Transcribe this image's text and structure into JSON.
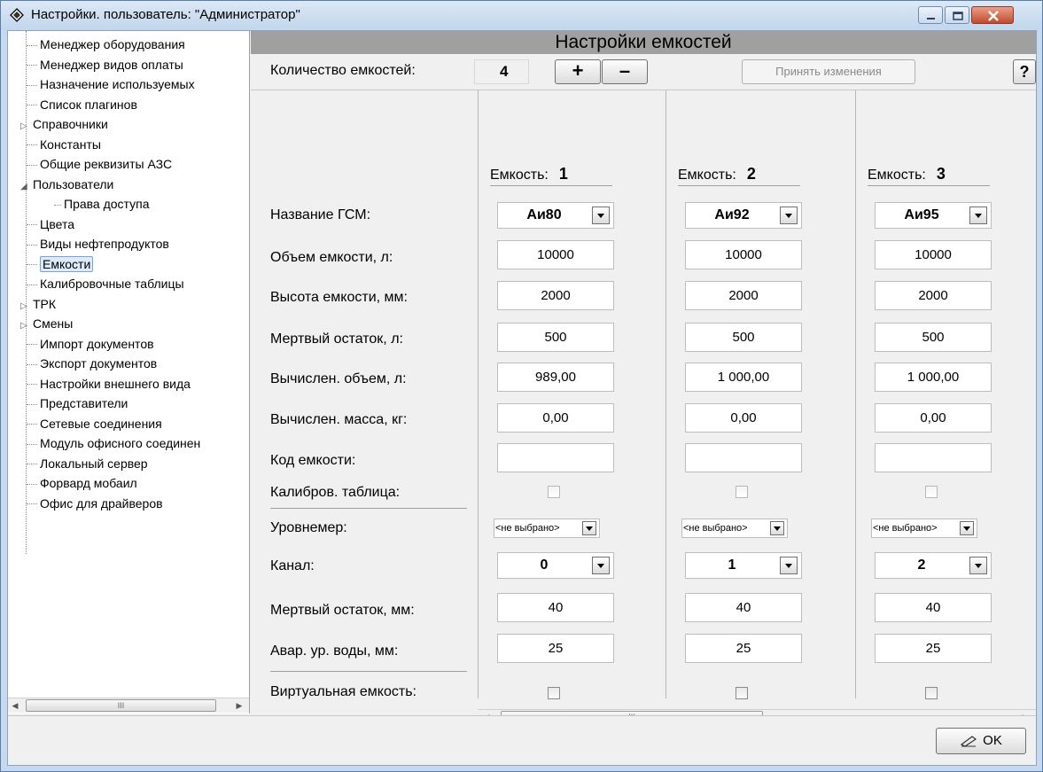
{
  "window": {
    "title": "Настройки. пользователь: \"Администратор\""
  },
  "tree": {
    "items": [
      {
        "label": "Менеджер оборудования",
        "expander": ""
      },
      {
        "label": "Менеджер видов оплаты",
        "expander": ""
      },
      {
        "label": "Назначение используемых",
        "expander": ""
      },
      {
        "label": "Список плагинов",
        "expander": ""
      },
      {
        "label": "Справочники",
        "expander": "▷"
      },
      {
        "label": "Константы",
        "expander": ""
      },
      {
        "label": "Общие реквизиты АЗС",
        "expander": ""
      },
      {
        "label": "Пользователи",
        "expander": "◢"
      },
      {
        "label": "Права доступа",
        "expander": "",
        "child": true
      },
      {
        "label": "Цвета",
        "expander": ""
      },
      {
        "label": "Виды нефтепродуктов",
        "expander": ""
      },
      {
        "label": "Емкости",
        "expander": "",
        "selected": true
      },
      {
        "label": "Калибровочные таблицы",
        "expander": ""
      },
      {
        "label": "ТРК",
        "expander": "▷"
      },
      {
        "label": "Смены",
        "expander": "▷"
      },
      {
        "label": "Импорт документов",
        "expander": ""
      },
      {
        "label": "Экспорт документов",
        "expander": ""
      },
      {
        "label": "Настройки внешнего вида",
        "expander": ""
      },
      {
        "label": "Представители",
        "expander": ""
      },
      {
        "label": "Сетевые соединения",
        "expander": ""
      },
      {
        "label": "Модуль офисного соединен",
        "expander": ""
      },
      {
        "label": "Локальный сервер",
        "expander": ""
      },
      {
        "label": "Форвард мобаил",
        "expander": ""
      },
      {
        "label": "Офис для драйверов",
        "expander": ""
      }
    ],
    "scroll_thumb_label": "III"
  },
  "panel": {
    "title": "Настройки емкостей",
    "count_label": "Количество емкостей:",
    "count_value": "4",
    "plus_label": "+",
    "minus_label": "–",
    "accept_label": "Принять изменения",
    "help_label": "?",
    "rows": {
      "fuel_name": "Название ГСМ:",
      "volume": "Объем емкости, л:",
      "height": "Высота емкости, мм:",
      "dead_rest_l": "Мертвый остаток, л:",
      "calc_volume": "Вычислен. объем, л:",
      "calc_mass": "Вычислен. масса, кг:",
      "code": "Код емкости:",
      "calib_table": "Калибров. таблица:",
      "level_gauge": "Уровнемер:",
      "channel": "Канал:",
      "dead_rest_mm": "Мертвый остаток, мм:",
      "water_alarm": "Авар. ур. воды, мм:",
      "virtual": "Виртуальная емкость:"
    },
    "tank_label": "Емкость:",
    "tanks": [
      {
        "num": "1",
        "fuel": "Аи80",
        "volume": "10000",
        "height": "2000",
        "dead_rest_l": "500",
        "calc_volume": "989,00",
        "calc_mass": "0,00",
        "code": "",
        "level_gauge": "<не выбрано>",
        "channel": "0",
        "dead_rest_mm": "40",
        "water_alarm": "25"
      },
      {
        "num": "2",
        "fuel": "Аи92",
        "volume": "10000",
        "height": "2000",
        "dead_rest_l": "500",
        "calc_volume": "1 000,00",
        "calc_mass": "0,00",
        "code": "",
        "level_gauge": "<не выбрано>",
        "channel": "1",
        "dead_rest_mm": "40",
        "water_alarm": "25"
      },
      {
        "num": "3",
        "fuel": "Аи95",
        "volume": "10000",
        "height": "2000",
        "dead_rest_l": "500",
        "calc_volume": "1 000,00",
        "calc_mass": "0,00",
        "code": "",
        "level_gauge": "<не выбрано>",
        "channel": "2",
        "dead_rest_mm": "40",
        "water_alarm": "25"
      }
    ],
    "scroll_thumb_label": "III"
  },
  "footer": {
    "ok_label": "OK"
  },
  "colors": {
    "titlebar": "#c3d6ec",
    "header_bar": "#a0a0a0",
    "selection": "#dcebfc"
  }
}
